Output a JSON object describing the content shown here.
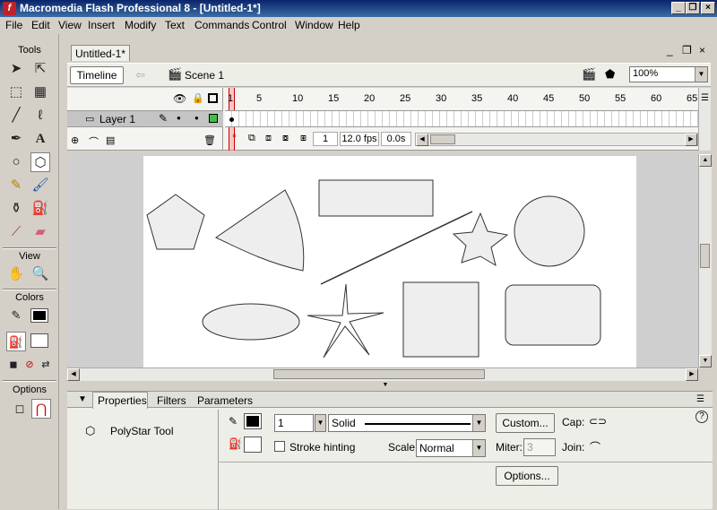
{
  "window": {
    "title": "Macromedia Flash Professional 8 - [Untitled-1*]"
  },
  "menu": [
    "File",
    "Edit",
    "View",
    "Insert",
    "Modify",
    "Text",
    "Commands",
    "Control",
    "Window",
    "Help"
  ],
  "tools": {
    "title": "Tools",
    "view_title": "View",
    "colors_title": "Colors",
    "options_title": "Options"
  },
  "document": {
    "tab": "Untitled-1*",
    "timeline_button": "Timeline",
    "scene": "Scene 1",
    "zoom": "100%"
  },
  "timeline": {
    "layer_name": "Layer 1",
    "frame_numbers": [
      "1",
      "5",
      "10",
      "15",
      "20",
      "25",
      "30",
      "35",
      "40",
      "45",
      "50",
      "55",
      "60",
      "65"
    ],
    "current_frame": "1",
    "fps": "12.0 fps",
    "time": "0.0s"
  },
  "properties": {
    "tabs": [
      "Properties",
      "Filters",
      "Parameters"
    ],
    "tool_name": "PolyStar Tool",
    "stroke_height": "1",
    "stroke_style": "Solid",
    "custom_button": "Custom...",
    "cap_label": "Cap:",
    "stroke_hinting_label": "Stroke hinting",
    "scale_label": "Scale:",
    "scale_value": "Normal",
    "miter_label": "Miter:",
    "miter_value": "3",
    "join_label": "Join:",
    "options_button": "Options..."
  },
  "colors": {
    "stroke": "#000000",
    "fill": "#ffffff",
    "shape_fill": "#eeeeee"
  }
}
